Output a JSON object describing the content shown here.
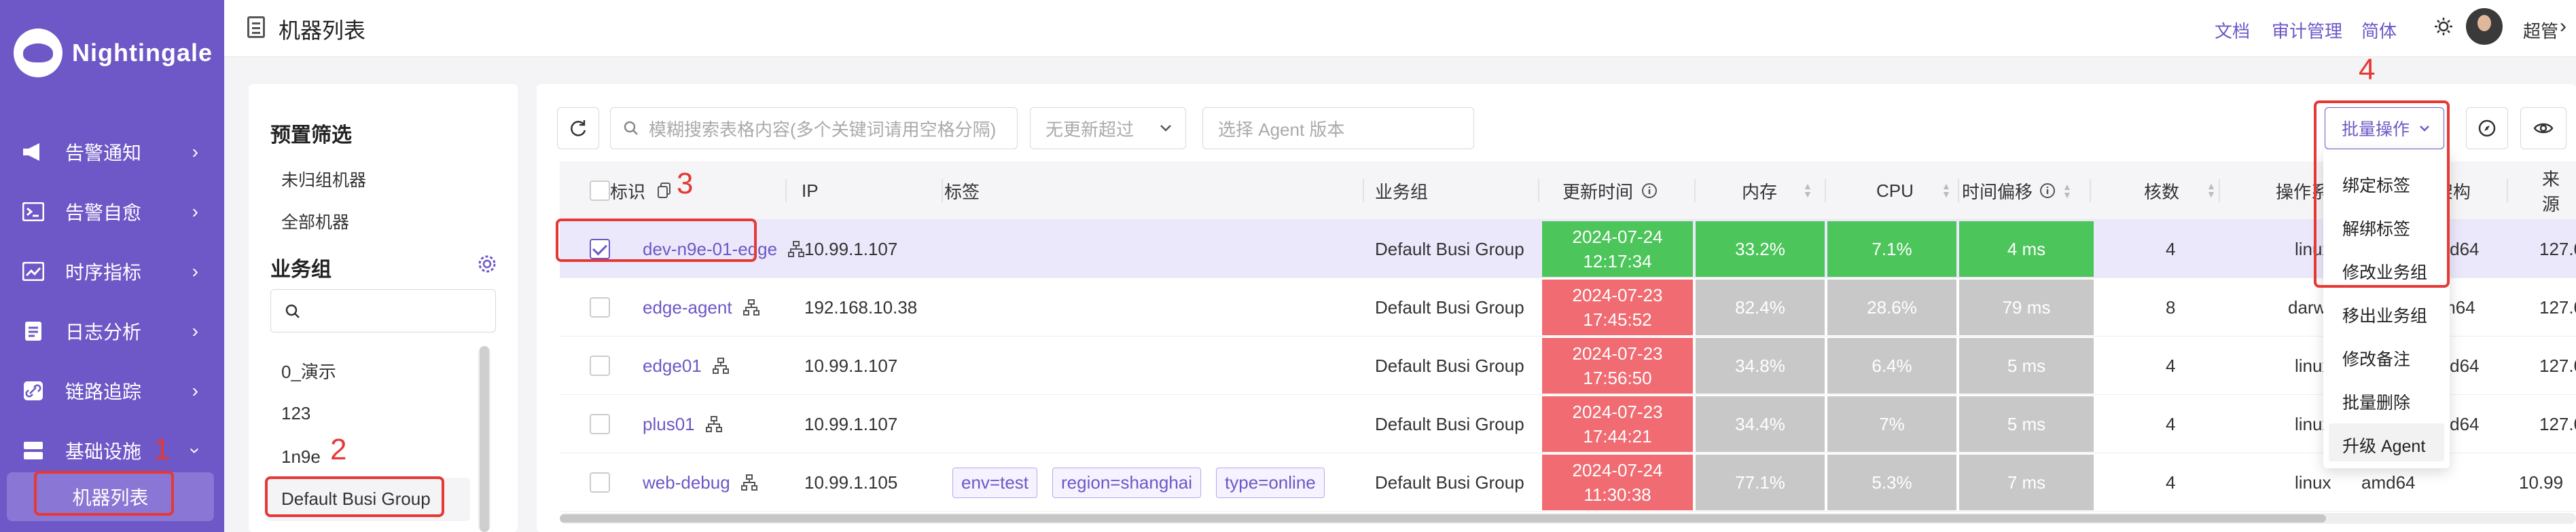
{
  "brand": {
    "name": "Nightingale"
  },
  "sidebar": {
    "items": [
      {
        "label": "告警通知",
        "icon": "megaphone-icon"
      },
      {
        "label": "告警自愈",
        "icon": "terminal-icon"
      },
      {
        "label": "时序指标",
        "icon": "line-chart-icon"
      },
      {
        "label": "日志分析",
        "icon": "document-icon"
      },
      {
        "label": "链路追踪",
        "icon": "link-icon"
      },
      {
        "label": "基础设施",
        "icon": "server-icon"
      }
    ],
    "active_sub": "机器列表"
  },
  "header": {
    "title": "机器列表",
    "links": [
      "文档",
      "审计管理",
      "简体"
    ],
    "user": "超管"
  },
  "filter": {
    "preset_title": "预置筛选",
    "preset_items": [
      "未归组机器",
      "全部机器"
    ],
    "group_title": "业务组",
    "groups": [
      "0_演示",
      "123",
      "1n9e",
      "Default Busi Group"
    ]
  },
  "toolbar": {
    "search_placeholder": "模糊搜索表格内容(多个关键词请用空格分隔)",
    "update_select": "无更新超过",
    "agent_placeholder": "选择 Agent 版本",
    "batch_label": "批量操作"
  },
  "table": {
    "columns": [
      "标识",
      "IP",
      "标签",
      "业务组",
      "更新时间",
      "内存",
      "CPU",
      "时间偏移",
      "核数",
      "操作系统",
      "CPU架构",
      "来源"
    ],
    "rows": [
      {
        "ident": "dev-n9e-01-edge",
        "ip": "10.99.1.107",
        "tags": [],
        "group": "Default Busi Group",
        "date": "2024-07-24",
        "time": "12:17:34",
        "mem": "33.2%",
        "cpu": "7.1%",
        "offset": "4 ms",
        "cores": "4",
        "os": "linux",
        "arch": "amd64",
        "source": "127.0",
        "status": "green",
        "checked": true
      },
      {
        "ident": "edge-agent",
        "ip": "192.168.10.38",
        "tags": [],
        "group": "Default Busi Group",
        "date": "2024-07-23",
        "time": "17:45:52",
        "mem": "82.4%",
        "cpu": "28.6%",
        "offset": "79 ms",
        "cores": "8",
        "os": "darwin",
        "arch": "arm64",
        "source": "127.0",
        "status": "red",
        "checked": false
      },
      {
        "ident": "edge01",
        "ip": "10.99.1.107",
        "tags": [],
        "group": "Default Busi Group",
        "date": "2024-07-23",
        "time": "17:56:50",
        "mem": "34.8%",
        "cpu": "6.4%",
        "offset": "5 ms",
        "cores": "4",
        "os": "linux",
        "arch": "amd64",
        "source": "127.0",
        "status": "red",
        "checked": false
      },
      {
        "ident": "plus01",
        "ip": "10.99.1.107",
        "tags": [],
        "group": "Default Busi Group",
        "date": "2024-07-23",
        "time": "17:44:21",
        "mem": "34.4%",
        "cpu": "7%",
        "offset": "5 ms",
        "cores": "4",
        "os": "linux",
        "arch": "amd64",
        "source": "127.0",
        "status": "red",
        "checked": false
      },
      {
        "ident": "web-debug",
        "ip": "10.99.1.105",
        "tags": [
          "env=test",
          "region=shanghai",
          "type=online"
        ],
        "group": "Default Busi Group",
        "date": "2024-07-24",
        "time": "11:30:38",
        "mem": "77.1%",
        "cpu": "5.3%",
        "offset": "7 ms",
        "cores": "4",
        "os": "linux",
        "arch": "amd64",
        "source": "10.99",
        "status": "red",
        "checked": false
      }
    ]
  },
  "dropdown": {
    "items": [
      "绑定标签",
      "解绑标签",
      "修改业务组",
      "移出业务组",
      "修改备注",
      "批量删除",
      "升级 Agent"
    ]
  },
  "annotations": [
    "1",
    "2",
    "3",
    "4"
  ],
  "colors": {
    "brand": "#6e57c6",
    "ok": "#4cc55a",
    "stale": "#f06b72",
    "inactive": "#c8c8c8",
    "highlight": "#e53935"
  }
}
